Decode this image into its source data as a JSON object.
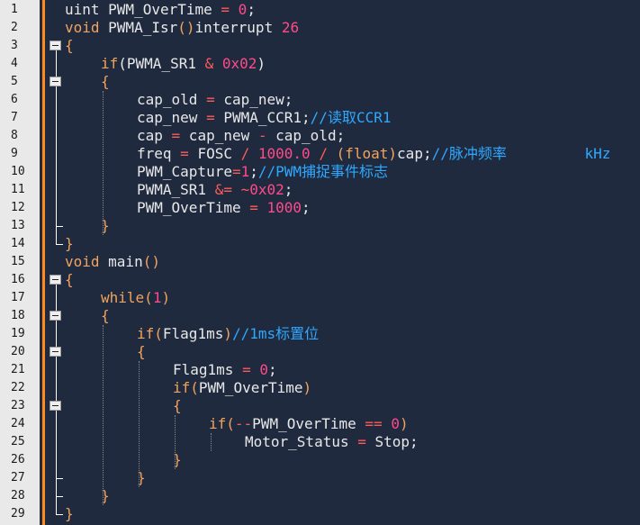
{
  "editor": {
    "line_numbers": [
      "1",
      "2",
      "3",
      "4",
      "5",
      "6",
      "7",
      "8",
      "9",
      "10",
      "11",
      "12",
      "13",
      "14",
      "15",
      "16",
      "17",
      "18",
      "19",
      "20",
      "21",
      "22",
      "23",
      "24",
      "25",
      "26",
      "27",
      "28",
      "29"
    ],
    "lines": [
      {
        "indent": 0,
        "tokens": [
          {
            "t": "tx",
            "v": "uint PWM_OverTime "
          },
          {
            "t": "op",
            "v": "="
          },
          {
            "t": "tx",
            "v": " "
          },
          {
            "t": "num",
            "v": "0"
          },
          {
            "t": "tx",
            "v": ";"
          }
        ]
      },
      {
        "indent": 0,
        "tokens": [
          {
            "t": "kw",
            "v": "void"
          },
          {
            "t": "tx",
            "v": " PWMA_Isr"
          },
          {
            "t": "kw",
            "v": "()"
          },
          {
            "t": "tx",
            "v": "interrupt "
          },
          {
            "t": "num",
            "v": "26"
          }
        ]
      },
      {
        "indent": 0,
        "tokens": [
          {
            "t": "kw",
            "v": "{"
          }
        ]
      },
      {
        "indent": 1,
        "tokens": [
          {
            "t": "kw",
            "v": "if"
          },
          {
            "t": "tx",
            "v": "(PWMA_SR1 "
          },
          {
            "t": "op",
            "v": "&"
          },
          {
            "t": "tx",
            "v": " "
          },
          {
            "t": "num",
            "v": "0x02"
          },
          {
            "t": "tx",
            "v": ")"
          }
        ]
      },
      {
        "indent": 1,
        "tokens": [
          {
            "t": "kw",
            "v": "{"
          }
        ]
      },
      {
        "indent": 2,
        "tokens": [
          {
            "t": "tx",
            "v": "cap_old "
          },
          {
            "t": "op",
            "v": "="
          },
          {
            "t": "tx",
            "v": " cap_new;"
          }
        ]
      },
      {
        "indent": 2,
        "tokens": [
          {
            "t": "tx",
            "v": "cap_new "
          },
          {
            "t": "op",
            "v": "="
          },
          {
            "t": "tx",
            "v": " PWMA_CCR1;"
          },
          {
            "t": "cm",
            "v": "//读取CCR1"
          }
        ]
      },
      {
        "indent": 2,
        "tokens": [
          {
            "t": "tx",
            "v": "cap "
          },
          {
            "t": "op",
            "v": "="
          },
          {
            "t": "tx",
            "v": " cap_new "
          },
          {
            "t": "op",
            "v": "-"
          },
          {
            "t": "tx",
            "v": " cap_old;"
          }
        ]
      },
      {
        "indent": 2,
        "tokens": [
          {
            "t": "tx",
            "v": "freq "
          },
          {
            "t": "op",
            "v": "="
          },
          {
            "t": "tx",
            "v": " FOSC "
          },
          {
            "t": "op",
            "v": "/"
          },
          {
            "t": "tx",
            "v": " "
          },
          {
            "t": "num",
            "v": "1000.0"
          },
          {
            "t": "tx",
            "v": " "
          },
          {
            "t": "op",
            "v": "/"
          },
          {
            "t": "tx",
            "v": " "
          },
          {
            "t": "kw",
            "v": "(float)"
          },
          {
            "t": "tx",
            "v": "cap;"
          },
          {
            "t": "cm",
            "v": "//脉冲频率         kHz"
          }
        ]
      },
      {
        "indent": 2,
        "tokens": [
          {
            "t": "tx",
            "v": "PWM_Capture"
          },
          {
            "t": "op",
            "v": "="
          },
          {
            "t": "num",
            "v": "1"
          },
          {
            "t": "tx",
            "v": ";"
          },
          {
            "t": "cm",
            "v": "//PWM捕捉事件标志"
          }
        ]
      },
      {
        "indent": 2,
        "tokens": [
          {
            "t": "tx",
            "v": "PWMA_SR1 "
          },
          {
            "t": "op",
            "v": "&="
          },
          {
            "t": "tx",
            "v": " "
          },
          {
            "t": "op",
            "v": "~"
          },
          {
            "t": "num",
            "v": "0x02"
          },
          {
            "t": "tx",
            "v": ";"
          }
        ]
      },
      {
        "indent": 2,
        "tokens": [
          {
            "t": "tx",
            "v": "PWM_OverTime "
          },
          {
            "t": "op",
            "v": "="
          },
          {
            "t": "tx",
            "v": " "
          },
          {
            "t": "num",
            "v": "1000"
          },
          {
            "t": "tx",
            "v": ";"
          }
        ]
      },
      {
        "indent": 1,
        "tokens": [
          {
            "t": "kw",
            "v": "}"
          }
        ]
      },
      {
        "indent": 0,
        "tokens": [
          {
            "t": "kw",
            "v": "}"
          }
        ]
      },
      {
        "indent": 0,
        "tokens": [
          {
            "t": "kw",
            "v": "void"
          },
          {
            "t": "tx",
            "v": " main"
          },
          {
            "t": "kw",
            "v": "()"
          }
        ]
      },
      {
        "indent": 0,
        "tokens": [
          {
            "t": "kw",
            "v": "{"
          }
        ]
      },
      {
        "indent": 1,
        "tokens": [
          {
            "t": "kw",
            "v": "while"
          },
          {
            "t": "kw",
            "v": "("
          },
          {
            "t": "num",
            "v": "1"
          },
          {
            "t": "kw",
            "v": ")"
          }
        ]
      },
      {
        "indent": 1,
        "tokens": [
          {
            "t": "kw",
            "v": "{"
          }
        ]
      },
      {
        "indent": 2,
        "tokens": [
          {
            "t": "kw",
            "v": "if"
          },
          {
            "t": "kw",
            "v": "("
          },
          {
            "t": "tx",
            "v": "Flag1ms"
          },
          {
            "t": "kw",
            "v": ")"
          },
          {
            "t": "cm",
            "v": "//1ms标置位"
          }
        ]
      },
      {
        "indent": 2,
        "tokens": [
          {
            "t": "kw",
            "v": "{"
          }
        ]
      },
      {
        "indent": 3,
        "tokens": [
          {
            "t": "tx",
            "v": "Flag1ms "
          },
          {
            "t": "op",
            "v": "="
          },
          {
            "t": "tx",
            "v": " "
          },
          {
            "t": "num",
            "v": "0"
          },
          {
            "t": "tx",
            "v": ";"
          }
        ]
      },
      {
        "indent": 3,
        "tokens": [
          {
            "t": "kw",
            "v": "if"
          },
          {
            "t": "kw",
            "v": "("
          },
          {
            "t": "tx",
            "v": "PWM_OverTime"
          },
          {
            "t": "kw",
            "v": ")"
          }
        ]
      },
      {
        "indent": 3,
        "tokens": [
          {
            "t": "kw",
            "v": "{"
          }
        ]
      },
      {
        "indent": 4,
        "tokens": [
          {
            "t": "kw",
            "v": "if"
          },
          {
            "t": "kw",
            "v": "("
          },
          {
            "t": "op",
            "v": "--"
          },
          {
            "t": "tx",
            "v": "PWM_OverTime "
          },
          {
            "t": "op",
            "v": "=="
          },
          {
            "t": "tx",
            "v": " "
          },
          {
            "t": "num",
            "v": "0"
          },
          {
            "t": "kw",
            "v": ")"
          }
        ]
      },
      {
        "indent": 5,
        "tokens": [
          {
            "t": "tx",
            "v": "Motor_Status "
          },
          {
            "t": "op",
            "v": "="
          },
          {
            "t": "tx",
            "v": " Stop;"
          }
        ]
      },
      {
        "indent": 3,
        "tokens": [
          {
            "t": "kw",
            "v": "}"
          }
        ]
      },
      {
        "indent": 2,
        "tokens": [
          {
            "t": "kw",
            "v": "}"
          }
        ]
      },
      {
        "indent": 1,
        "tokens": [
          {
            "t": "kw",
            "v": "}"
          }
        ]
      },
      {
        "indent": 0,
        "tokens": [
          {
            "t": "kw",
            "v": "}"
          }
        ]
      }
    ],
    "fold_markers": [
      3,
      5,
      16,
      18,
      20,
      23
    ]
  },
  "colors": {
    "background": "#1f2a3f",
    "gutter": "#e9e9e9",
    "change_bar": "#ff8c1a",
    "keyword": "#f2a35e",
    "number": "#ff4a8a",
    "comment": "#2fa8ff",
    "operator": "#ff5a5a",
    "text": "#e8e8e8"
  }
}
